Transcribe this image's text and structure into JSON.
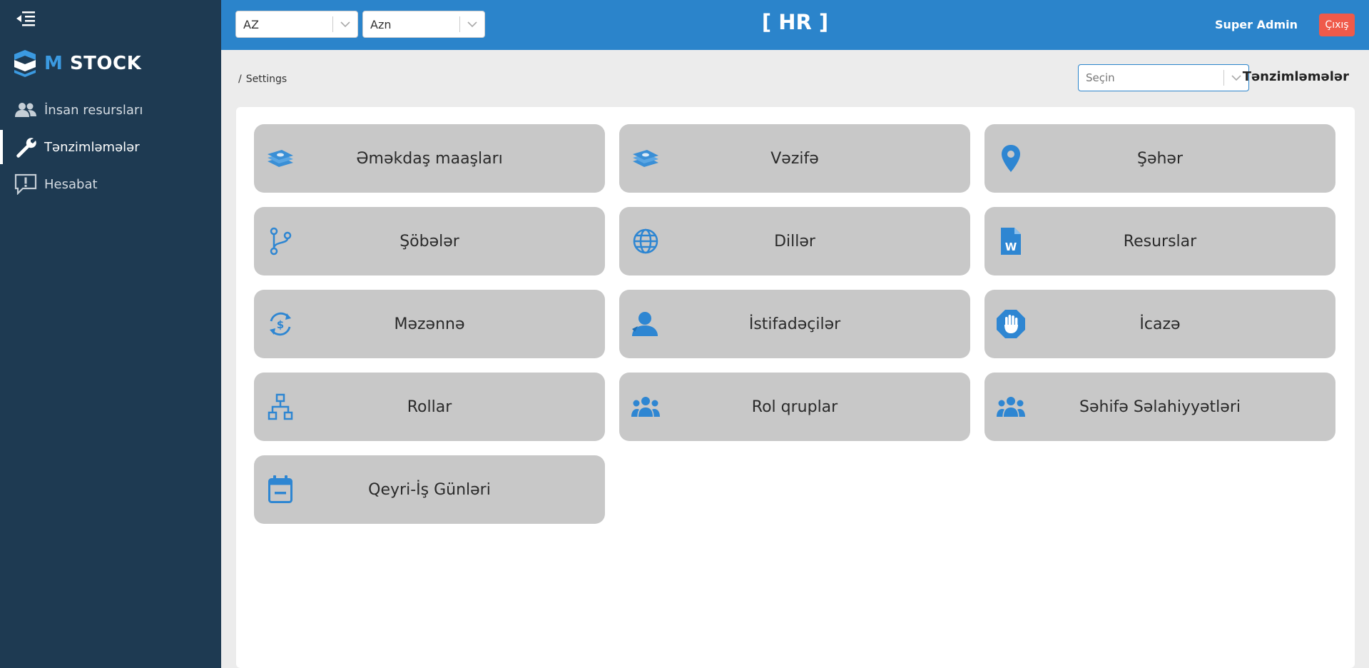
{
  "app": {
    "logo_prefix": "M",
    "logo_name": "STOCK",
    "module_title": "[ HR ]"
  },
  "sidebar": {
    "items": [
      {
        "label": "İnsan resursları",
        "icon": "users-icon",
        "active": false
      },
      {
        "label": "Tənzimləmələr",
        "icon": "wrench-icon",
        "active": true
      },
      {
        "label": "Hesabat",
        "icon": "report-icon",
        "active": false
      }
    ]
  },
  "header": {
    "language_select": {
      "value": "AZ"
    },
    "currency_select": {
      "value": "Azn"
    },
    "user_name": "Super Admin",
    "logout_label": "Çıxış"
  },
  "subheader": {
    "breadcrumb_sep": "/",
    "breadcrumb": "Settings",
    "select_placeholder": "Seçin",
    "page_title": "Tənzimləmələr"
  },
  "tiles": [
    {
      "label": "Əməkdaş maaşları",
      "icon": "money-stack-icon"
    },
    {
      "label": "Vəzifə",
      "icon": "money-stack-icon"
    },
    {
      "label": "Şəhər",
      "icon": "map-pin-icon"
    },
    {
      "label": "Şöbələr",
      "icon": "branch-icon"
    },
    {
      "label": "Dillər",
      "icon": "globe-icon"
    },
    {
      "label": "Resurslar",
      "icon": "word-file-icon"
    },
    {
      "label": "Məzənnə",
      "icon": "currency-exchange-icon"
    },
    {
      "label": "İstifadəçilər",
      "icon": "user-icon"
    },
    {
      "label": "İcazə",
      "icon": "hand-stop-icon"
    },
    {
      "label": "Rollar",
      "icon": "sitemap-icon"
    },
    {
      "label": "Rol qruplar",
      "icon": "users-group-icon"
    },
    {
      "label": "Səhifə Səlahiyyətləri",
      "icon": "users-group-icon"
    },
    {
      "label": "Qeyri-İş Günləri",
      "icon": "calendar-minus-icon"
    }
  ],
  "colors": {
    "sidebar_bg": "#1e3a52",
    "topbar_bg": "#2b84cb",
    "accent": "#2b84cb",
    "logout_bg": "#ef5a4a",
    "tile_bg": "#c8c8c8"
  }
}
